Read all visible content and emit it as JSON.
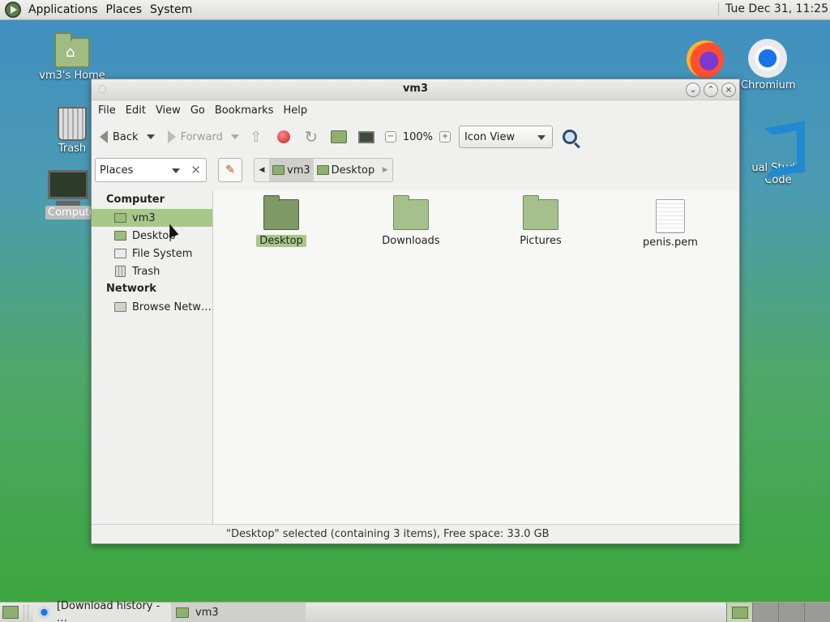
{
  "top_panel": {
    "menus": [
      "Applications",
      "Places",
      "System"
    ],
    "clock": "Tue Dec 31, 11:25"
  },
  "desktop": {
    "icons": {
      "home": "vm3's Home",
      "trash": "Trash",
      "computer": "Compute",
      "chromium": "Chromium",
      "vscode": "ual Studio Code"
    }
  },
  "window": {
    "title": "vm3",
    "menubar": [
      "File",
      "Edit",
      "View",
      "Go",
      "Bookmarks",
      "Help"
    ],
    "toolbar": {
      "back": "Back",
      "forward": "Forward",
      "zoom": "100%",
      "view_mode": "Icon View"
    },
    "location": {
      "places_label": "Places",
      "crumbs": [
        "vm3",
        "Desktop"
      ]
    },
    "sidebar": {
      "computer_heading": "Computer",
      "network_heading": "Network",
      "items": [
        "vm3",
        "Desktop",
        "File System",
        "Trash"
      ],
      "network_items": [
        "Browse Netw…"
      ]
    },
    "files": [
      "Desktop",
      "Downloads",
      "Pictures",
      "penis.pem"
    ],
    "status": "\"Desktop\" selected (containing 3 items), Free space: 33.0 GB"
  },
  "bottom_panel": {
    "tasks": [
      "[Download history - …",
      "vm3"
    ]
  },
  "colors": {
    "selection": "#a8c88a",
    "folder": "#a5c08c"
  }
}
